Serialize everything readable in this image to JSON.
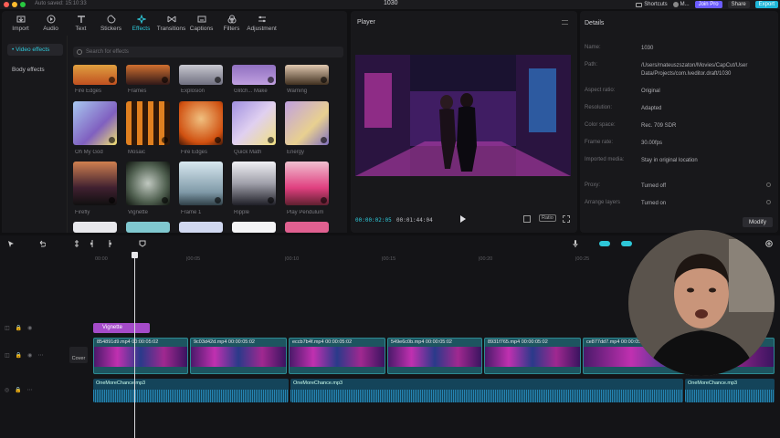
{
  "topbar": {
    "autosave": "Auto saved: 15:10:33",
    "title": "1030",
    "shortcuts": "Shortcuts",
    "user": "M...",
    "join_pro": "Join Pro",
    "share": "Share",
    "export": "Export"
  },
  "tools": [
    {
      "label": "Import",
      "icon": "import-icon"
    },
    {
      "label": "Audio",
      "icon": "audio-icon"
    },
    {
      "label": "Text",
      "icon": "text-icon"
    },
    {
      "label": "Stickers",
      "icon": "stickers-icon"
    },
    {
      "label": "Effects",
      "icon": "effects-icon"
    },
    {
      "label": "Transitions",
      "icon": "transitions-icon"
    },
    {
      "label": "Captions",
      "icon": "captions-icon"
    },
    {
      "label": "Filters",
      "icon": "filters-icon"
    },
    {
      "label": "Adjustment",
      "icon": "adjustment-icon"
    }
  ],
  "categories": [
    "• Video effects",
    "Body effects"
  ],
  "search": {
    "placeholder": "Search for effects"
  },
  "effects_row0": [
    "Fire Edges",
    "Frames",
    "Explosion",
    "Glitch... Make",
    "Warning"
  ],
  "effects_row1": [
    "Oh My God",
    "Mosaic",
    "Fire Edges",
    "Quick Math",
    "Energy"
  ],
  "effects_row2": [
    "Firefly",
    "Vignette",
    "Frame 1",
    "Ripple",
    "Play Pendulum"
  ],
  "player": {
    "title": "Player",
    "current": "00:00:02:05",
    "total": "00:01:44:04",
    "ratio": "Ratio"
  },
  "details": {
    "title": "Details",
    "rows": [
      {
        "k": "Name:",
        "v": "1030"
      },
      {
        "k": "Path:",
        "v": "/Users/mateuszszaton/Movies/CapCut/User Data/Projects/com.lveditor.draft/1030"
      },
      {
        "k": "Aspect ratio:",
        "v": "Original"
      },
      {
        "k": "Resolution:",
        "v": "Adapted"
      },
      {
        "k": "Color space:",
        "v": "Rec. 709 SDR"
      },
      {
        "k": "Frame rate:",
        "v": "30.00fps"
      },
      {
        "k": "Imported media:",
        "v": "Stay in original location"
      },
      {
        "k": "Proxy:",
        "v": "Turned off"
      },
      {
        "k": "Arrange layers",
        "v": "Turned on"
      }
    ],
    "modify": "Modify"
  },
  "timeline": {
    "ticks": [
      "00:00",
      "|00:05",
      "|00:10",
      "|00:15",
      "|00:20",
      "|00:25"
    ],
    "effect_clip": "Vignette",
    "cover": "Cover",
    "video_clips": [
      "854891d9.mp4  00:00:05:02",
      "9c03d42d.mp4  00:00:05:02",
      "eccb7b4f.mp4  00:00:05:02",
      "549e6c0b.mp4  00:00:05:02",
      "8931f765.mp4  00:00:05:02",
      "ce877dd7.mp4  00:00:05:02"
    ],
    "audio_clips": [
      "OneMoreChance.mp3",
      "OneMoreChance.mp3",
      "OneMoreChance.mp3"
    ]
  }
}
